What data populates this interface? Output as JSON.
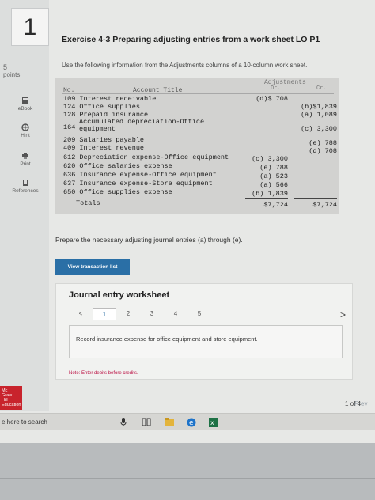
{
  "question": {
    "number": "1",
    "points_value": "5",
    "points_label": "points"
  },
  "sidebar": {
    "items": [
      {
        "label": "eBook",
        "icon": "book-icon"
      },
      {
        "label": "Hint",
        "icon": "hint-icon"
      },
      {
        "label": "Print",
        "icon": "print-icon"
      },
      {
        "label": "References",
        "icon": "references-icon"
      }
    ]
  },
  "logo": {
    "lines": [
      "Mc",
      "Graw",
      "Hill",
      "Education"
    ]
  },
  "exercise": {
    "title": "Exercise 4-3 Preparing adjusting entries from a work sheet LO P1",
    "instruction": "Use the following information from the Adjustments columns of a 10-column work sheet."
  },
  "worksheet": {
    "header_adjustments": "Adjustments",
    "header_dr": "Dr.",
    "header_cr": "Cr.",
    "header_no": "No.",
    "header_title": "Account Title",
    "rows": [
      {
        "account": "109 Interest receivable",
        "dr": "(d)$  708",
        "cr": ""
      },
      {
        "account": "124 Office supplies",
        "dr": "",
        "cr": "(b)$1,839"
      },
      {
        "account": "128 Prepaid insurance",
        "dr": "",
        "cr": "(a) 1,089"
      },
      {
        "account_no": "164",
        "account_l1": "Accumulated depreciation-Office",
        "account_l2": "equipment",
        "dr": "",
        "cr": "(c) 3,300"
      },
      {
        "account": "209 Salaries payable",
        "dr": "",
        "cr": "(e)    788"
      },
      {
        "account": "409 Interest revenue",
        "dr": "",
        "cr": "(d)    708"
      },
      {
        "account": "612 Depreciation expense-Office equipment",
        "dr": "(c) 3,300",
        "cr": ""
      },
      {
        "account": "620 Office salaries expense",
        "dr": "(e)   788",
        "cr": ""
      },
      {
        "account": "636 Insurance expense-Office equipment",
        "dr": "(a)   523",
        "cr": ""
      },
      {
        "account": "637 Insurance expense-Store equipment",
        "dr": "(a)   566",
        "cr": ""
      },
      {
        "account": "650 Office supplies expense",
        "dr": "(b) 1,839",
        "cr": ""
      }
    ],
    "totals_label": "Totals",
    "total_dr": "$7,724",
    "total_cr": "$7,724"
  },
  "prompt_text": "Prepare the necessary adjusting journal entries (a) through (e).",
  "view_button": "View transaction list",
  "journal": {
    "title": "Journal entry worksheet",
    "prev_arrow": "<",
    "next_arrow": ">",
    "pages": [
      "1",
      "2",
      "3",
      "4",
      "5"
    ],
    "current_page": "1",
    "instruction": "Record insurance expense for office equipment and store equipment.",
    "note": "Note: Enter debits before credits."
  },
  "nav": {
    "prev": "Prev",
    "page": "1",
    "of": "of",
    "total": "4"
  },
  "taskbar": {
    "search_text": "e here to search"
  }
}
